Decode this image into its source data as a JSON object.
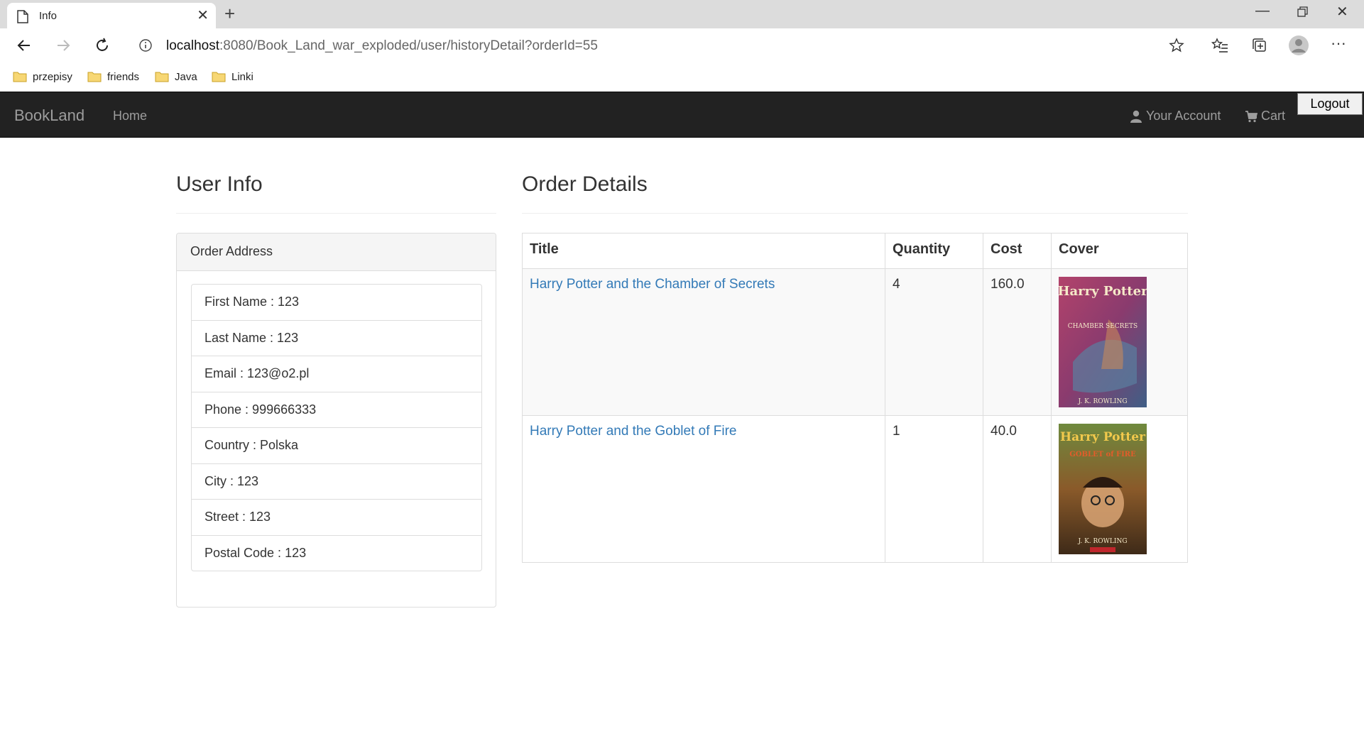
{
  "browser": {
    "tab_title": "Info",
    "url_host": "localhost",
    "url_rest": ":8080/Book_Land_war_exploded/user/historyDetail?orderId=55",
    "bookmarks": [
      "przepisy",
      "friends",
      "Java",
      "Linki"
    ]
  },
  "nav": {
    "brand": "BookLand",
    "home": "Home",
    "account": "Your Account",
    "cart": "Cart",
    "logout": "Logout"
  },
  "user_info": {
    "heading": "User Info",
    "panel_title": "Order Address",
    "items": [
      "First Name : 123",
      "Last Name : 123",
      "Email : 123@o2.pl",
      "Phone : 999666333",
      "Country : Polska",
      "City : 123",
      "Street : 123",
      "Postal Code : 123"
    ]
  },
  "order_details": {
    "heading": "Order Details",
    "columns": [
      "Title",
      "Quantity",
      "Cost",
      "Cover"
    ],
    "rows": [
      {
        "title": "Harry Potter and the Chamber of Secrets",
        "quantity": "4",
        "cost": "160.0",
        "cover_text": "Harry Potter",
        "cover_sub": "CHAMBER SECRETS",
        "cover_author": "J. K. ROWLING"
      },
      {
        "title": "Harry Potter and the Goblet of Fire",
        "quantity": "1",
        "cost": "40.0",
        "cover_text": "Harry Potter",
        "cover_sub": "GOBLET of FIRE",
        "cover_author": "J. K. ROWLING"
      }
    ]
  },
  "colors": {
    "navbar_bg": "#222222",
    "nav_text": "#9d9d9d",
    "link": "#337ab7"
  }
}
